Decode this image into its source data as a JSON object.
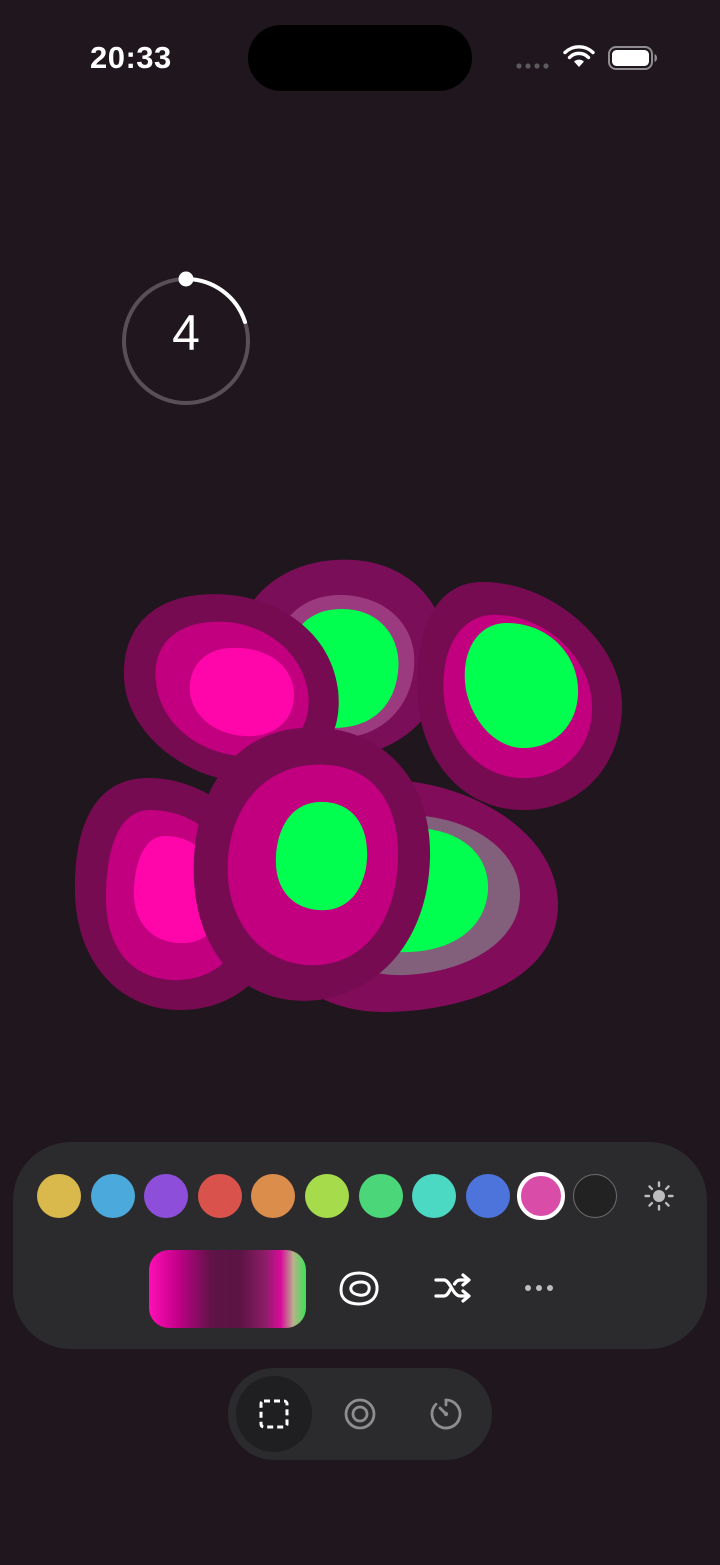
{
  "status_bar": {
    "time": "20:33"
  },
  "timer": {
    "value": "4",
    "progress": 0.2
  },
  "palette": {
    "swatches": [
      {
        "name": "yellow",
        "color": "#d9b84c"
      },
      {
        "name": "blue",
        "color": "#4ca9db"
      },
      {
        "name": "purple",
        "color": "#8d4fd9"
      },
      {
        "name": "red",
        "color": "#d9534c"
      },
      {
        "name": "orange",
        "color": "#db8e4c"
      },
      {
        "name": "lime",
        "color": "#a6db4c"
      },
      {
        "name": "green",
        "color": "#4cd67a"
      },
      {
        "name": "teal",
        "color": "#4cd9c4"
      },
      {
        "name": "indigo",
        "color": "#4c74db"
      },
      {
        "name": "pink",
        "color": "#d94ca8",
        "selected": true
      },
      {
        "name": "none",
        "color": "#222222",
        "empty": true
      }
    ],
    "brightness_icon": "sun-icon"
  },
  "tools": {
    "gradient_preview": "gradient-swatch",
    "shape_icon": "blob-shape-icon",
    "shuffle_icon": "shuffle-icon",
    "more_icon": "ellipsis-icon"
  },
  "modes": [
    {
      "name": "select",
      "icon": "dashed-square-icon",
      "active": true
    },
    {
      "name": "record",
      "icon": "record-circle-icon",
      "active": false
    },
    {
      "name": "timer",
      "icon": "timer-icon",
      "active": false
    }
  ],
  "colors": {
    "background": "#20161d",
    "blob_outer": "#7a0e58",
    "blob_mid": "#c2007f",
    "blob_core_pink": "#ff06ab",
    "blob_core_green": "#00ff4e"
  }
}
